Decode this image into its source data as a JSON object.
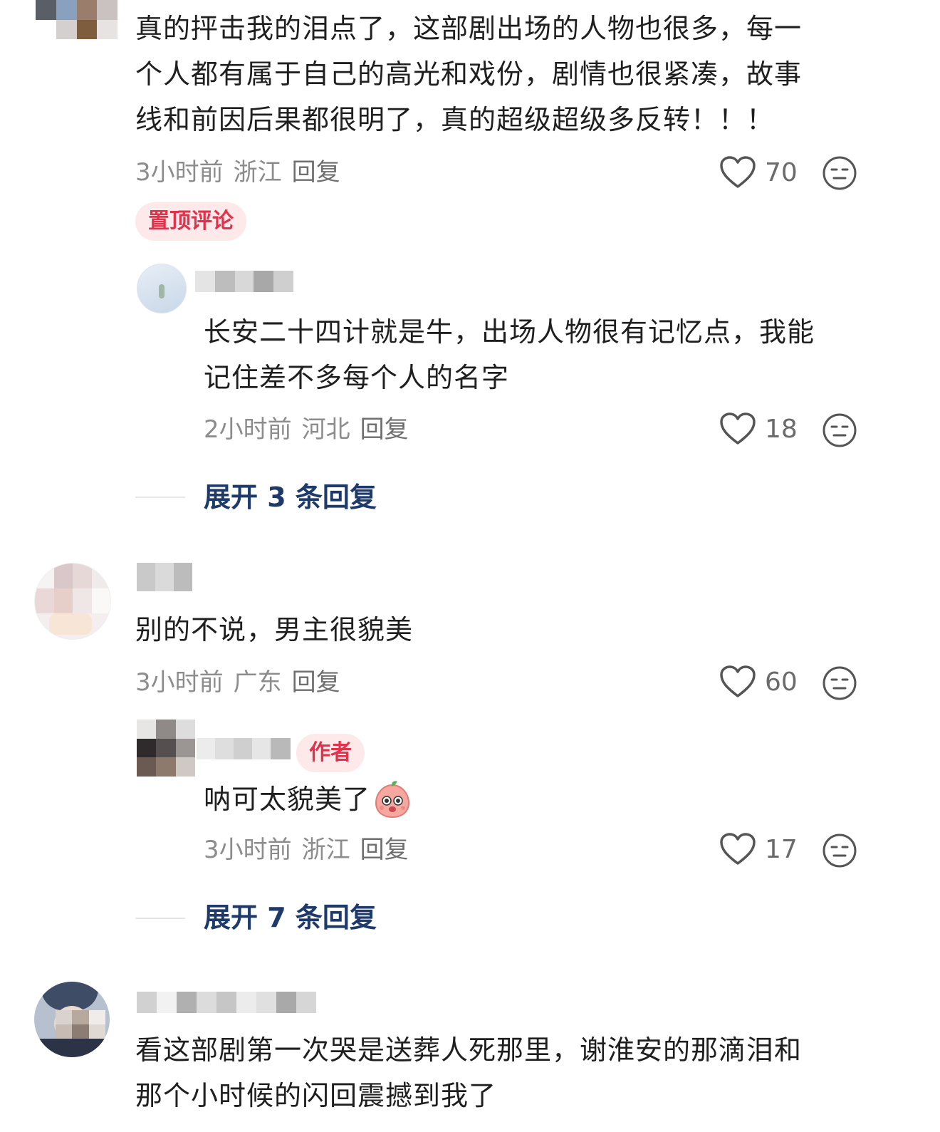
{
  "comments": [
    {
      "text": "真的抨击我的泪点了，这部剧出场的人物也很多，每一个人都有属于自己的高光和戏份，剧情也很紧凑，故事线和前因后果都很明了，真的超级超级多反转！！！",
      "line1": "真的抨击我的泪点了，这部剧出场的人物也很多，每一",
      "line2": "个人都有属于自己的高光和戏份，剧情也很紧凑，故事",
      "line3": "线和前因后果都很明了，真的超级超级多反转！！！",
      "time": "3小时前",
      "location": "浙江",
      "reply_label": "回复",
      "likes": "70",
      "badge": "置顶评论",
      "reply": {
        "line1": "长安二十四计就是牛，出场人物很有记忆点，我能",
        "line2": "记住差不多每个人的名字",
        "time": "2小时前",
        "location": "河北",
        "reply_label": "回复",
        "likes": "18"
      },
      "expand_label": "展开 3 条回复"
    },
    {
      "line1": "别的不说，男主很貌美",
      "time": "3小时前",
      "location": "广东",
      "reply_label": "回复",
      "likes": "60",
      "reply": {
        "badge": "作者",
        "line1": "呐可太貌美了",
        "time": "3小时前",
        "location": "浙江",
        "reply_label": "回复",
        "likes": "17"
      },
      "expand_label": "展开 7 条回复"
    },
    {
      "line1": "看这部剧第一次哭是送葬人死那里，谢淮安的那滴泪和",
      "line2": "那个小时候的闪回震撼到我了"
    }
  ],
  "icons": {
    "like": "heart-outline-icon",
    "emoji": "neutral-face-icon",
    "sticker": "peach-emoji-icon"
  },
  "colors": {
    "badge_text": "#e0324a",
    "badge_bg": "#fde8ea",
    "expand_text": "#1d3a6b",
    "meta_text": "#8c8c8c"
  }
}
